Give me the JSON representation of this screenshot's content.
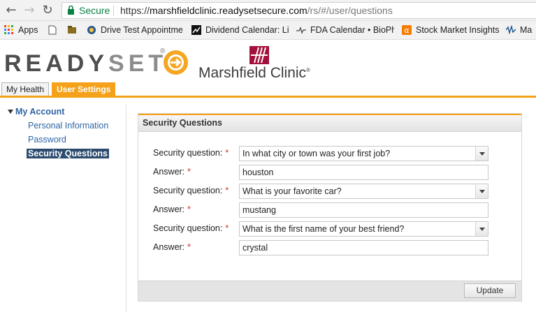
{
  "browser": {
    "secure_label": "Secure",
    "url_scheme": "https://",
    "url_host": "marshfieldclinic.readysetsecure.com",
    "url_path": "/rs/#/user/questions"
  },
  "bookmarks": [
    {
      "label": "Apps",
      "icon": "apps-grid-icon"
    },
    {
      "label": "",
      "icon": "page-icon"
    },
    {
      "label": "",
      "icon": "folder-icon"
    },
    {
      "label": "Drive Test Appointme",
      "icon": "dmv-icon"
    },
    {
      "label": "Dividend Calendar: Li",
      "icon": "chart-icon"
    },
    {
      "label": "FDA Calendar • BioPh",
      "icon": "pulse-icon"
    },
    {
      "label": "Stock Market Insights",
      "icon": "alpha-icon"
    },
    {
      "label": "Ma",
      "icon": "wave-icon"
    }
  ],
  "header": {
    "logo_ready": "READY",
    "logo_set": "SET",
    "logo_reg": "®",
    "clinic_name": "Marshfield Clinic",
    "clinic_reg": "®"
  },
  "tabs": [
    {
      "label": "My Health"
    },
    {
      "label": "User Settings"
    }
  ],
  "sidebar": {
    "section": "My Account",
    "items": [
      {
        "label": "Personal Information"
      },
      {
        "label": "Password"
      },
      {
        "label": "Security Questions"
      }
    ]
  },
  "panel": {
    "title": "Security Questions",
    "question_label": "Security question:",
    "answer_label": "Answer:",
    "required_mark": "*",
    "questions": [
      {
        "question": "In what city or town was your first job?",
        "answer": "houston"
      },
      {
        "question": "What is your favorite car?",
        "answer": "mustang"
      },
      {
        "question": "What is the first name of your best friend?",
        "answer": "crystal"
      }
    ],
    "update_label": "Update"
  },
  "colors": {
    "accent": "#f5a11a",
    "link": "#2d64a3",
    "active_nav": "#2c4b6f",
    "secure_green": "#0b8043",
    "required": "#d32f2f"
  }
}
